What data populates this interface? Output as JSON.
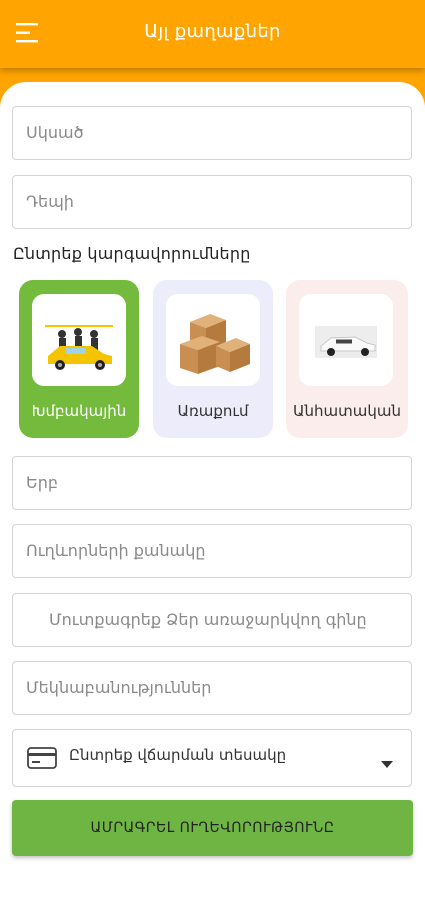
{
  "header": {
    "title": "Այլ քաղաքներ",
    "menu_icon": "menu-icon"
  },
  "form": {
    "from_placeholder": "Սկսած",
    "to_placeholder": "Դեպի",
    "select_mode_label": "Ընտրեք կարգավորումները",
    "when_placeholder": "Երբ",
    "passengers_placeholder": "Ուղևորների քանակը",
    "price_placeholder": "Մուտքագրեք Ձեր առաջարկվող գինը",
    "notes_placeholder": "Մեկնաբանություններ",
    "payment_placeholder": "Ընտրեք վճարման տեսակը",
    "submit_label": "ԱՄՐԱԳՐԵԼ ՈՒՂԵՎՈՐՈՒԹՅՈՒՆԸ"
  },
  "options": [
    {
      "label": "Խմբակային",
      "icon": "group-taxi-icon",
      "selected": true,
      "color": "#74BA3D"
    },
    {
      "label": "Առաքում",
      "icon": "delivery-boxes-icon",
      "selected": false,
      "color": "#ECECFB"
    },
    {
      "label": "Անհատական",
      "icon": "private-car-icon",
      "selected": false,
      "color": "#FBEDEB"
    }
  ],
  "colors": {
    "accent": "#FFA400",
    "submit": "#6FB544"
  }
}
